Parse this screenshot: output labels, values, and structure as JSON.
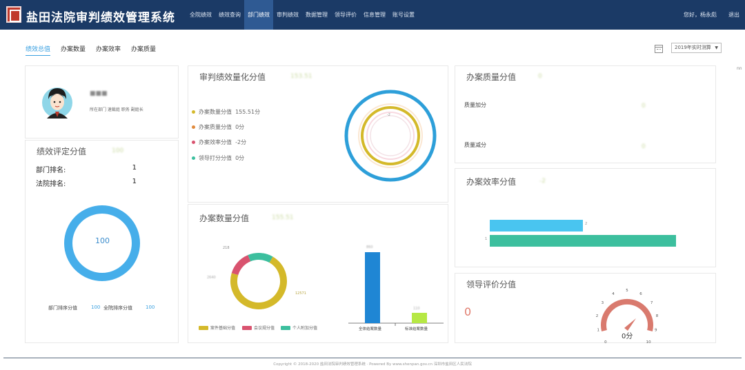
{
  "header": {
    "title": "盐田法院审判绩效管理系统",
    "nav": [
      "全院绩效",
      "绩效查询",
      "部门绩效",
      "审判绩效",
      "数据管理",
      "领导评价",
      "信息管理",
      "账号设置"
    ],
    "active_nav": "部门绩效",
    "user_greeting": "您好，杨永彪",
    "logout": "退出"
  },
  "subtabs": [
    "绩效总值",
    "办案数量",
    "办案效率",
    "办案质量"
  ],
  "active_subtab": "绩效总值",
  "period": "2019年实时测算",
  "edge_text": "nn",
  "profile": {
    "name": "■■■",
    "sub": "所在部门 速裁庭 职务 副庭长"
  },
  "rating_panel": {
    "title": "绩效评定分值",
    "value": "100",
    "dept_rank_label": "部门排名:",
    "dept_rank": "1",
    "court_rank_label": "法院排名:",
    "court_rank": "1",
    "ring_value": "100",
    "dept_score_label": "部门排序分值",
    "dept_score": "100",
    "court_score_label": "全院排序分值",
    "court_score": "100"
  },
  "quant_panel": {
    "title": "审判绩效量化分值",
    "value": "153.51",
    "items": [
      {
        "label": "办案数量分值",
        "value": "155.51分",
        "color": "#d4b92a"
      },
      {
        "label": "办案质量分值",
        "value": "0分",
        "color": "#e08a3c"
      },
      {
        "label": "办案效率分值",
        "value": "-2分",
        "color": "#d9536f"
      },
      {
        "label": "领导打分分值",
        "value": "0分",
        "color": "#3cbf9e"
      }
    ],
    "ring_label": "-2"
  },
  "quantity_panel": {
    "title": "办案数量分值",
    "value": "155.51",
    "donut_labels": {
      "top": "218",
      "left": "2640",
      "right": "12571"
    },
    "legend": [
      {
        "label": "案件基础分值",
        "color": "#d4b92a"
      },
      {
        "label": "会议规分值",
        "color": "#d9536f"
      },
      {
        "label": "个人附加分值",
        "color": "#3cbf9e"
      }
    ],
    "bar_labels": [
      "全体结案数量",
      "标准结案数量"
    ],
    "bar_top_values": [
      "860",
      "110"
    ],
    "bar_colors": [
      "#1f86d4",
      "#b6e844"
    ]
  },
  "quality_panel": {
    "title": "办案质量分值",
    "value": "0",
    "plus_label": "质量加分",
    "plus_value": "0",
    "minus_label": "质量减分",
    "minus_value": "0"
  },
  "efficiency_panel": {
    "title": "办案效率分值",
    "value": "-2",
    "bars": [
      {
        "value": 2,
        "label": "2",
        "color": "#49c5f0"
      },
      {
        "value": 1,
        "label": "1",
        "color": "#3cbf9e"
      }
    ]
  },
  "leader_panel": {
    "title": "领导评价分值",
    "value": "0",
    "gauge_ticks": [
      "0",
      "1",
      "2",
      "3",
      "4",
      "5",
      "6",
      "7",
      "8",
      "9",
      "10"
    ],
    "gauge_readout": "0分",
    "gauge_level": 0
  },
  "footer": "Copyright © 2018-2020 盐田法院审判绩效管理系统 · Powered By www.shenpan.gov.cn 深圳市盐田区人民法院"
}
